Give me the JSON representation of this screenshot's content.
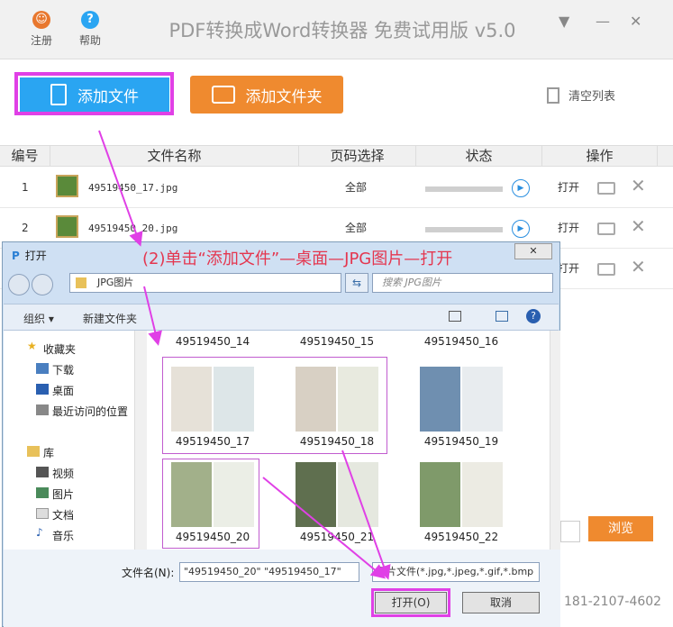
{
  "header": {
    "title": "PDF转换成Word转换器 免费试用版 v5.0",
    "register_label": "注册",
    "help_label": "帮助"
  },
  "toolbar": {
    "add_file_label": "添加文件",
    "add_folder_label": "添加文件夹",
    "clear_list_label": "清空列表"
  },
  "table": {
    "columns": [
      "编号",
      "文件名称",
      "页码选择",
      "状态",
      "操作"
    ],
    "rows": [
      {
        "num": "1",
        "name": "49519450_17.jpg",
        "pages": "全部",
        "open": "打开"
      },
      {
        "num": "2",
        "name": "49519450_20.jpg",
        "pages": "全部",
        "open": "打开"
      },
      {
        "open": "打开"
      }
    ]
  },
  "footer": {
    "browse_label": "浏览",
    "phone": "181-2107-4602"
  },
  "dialog": {
    "title": "打开",
    "annotation": "(2)单击“添加文件”—桌面—JPG图片—打开",
    "address": "JPG图片",
    "search_placeholder": "搜索 JPG图片",
    "organize_label": "组织 ▾",
    "new_folder_label": "新建文件夹",
    "nav": {
      "favorites": "收藏夹",
      "downloads": "下载",
      "desktop": "桌面",
      "recent": "最近访问的位置",
      "libraries": "库",
      "videos": "视频",
      "pictures": "图片",
      "documents": "文档",
      "music": "音乐"
    },
    "files": {
      "top": [
        "49519450_14",
        "49519450_15",
        "49519450_16"
      ],
      "row1": [
        "49519450_17",
        "49519450_18",
        "49519450_19"
      ],
      "row2": [
        "49519450_20",
        "49519450_21",
        "49519450_22"
      ]
    },
    "filename_label": "文件名(N):",
    "filename_value": "\"49519450_20\" \"49519450_17\"",
    "filetype_value": "图片文件(*.jpg,*.jpeg,*.gif,*.bmp",
    "open_label": "打开(O)",
    "cancel_label": "取消"
  },
  "colors": {
    "accent_blue": "#2aa5f2",
    "accent_orange": "#ef8a2f",
    "highlight": "#e040e6",
    "annotation_red": "#e4364f"
  }
}
